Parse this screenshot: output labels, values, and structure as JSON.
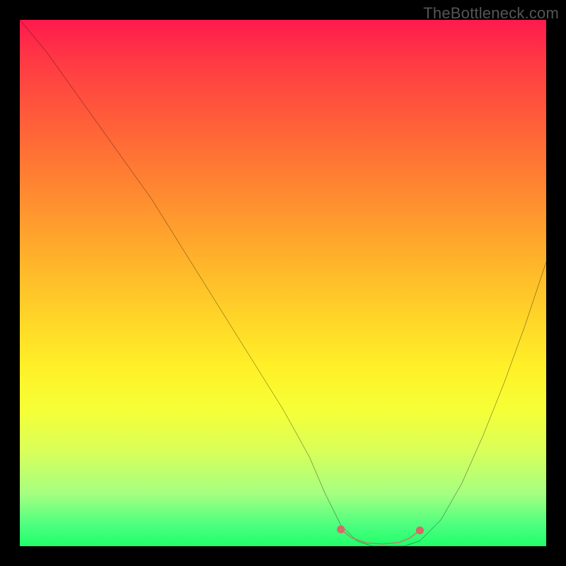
{
  "attribution": "TheBottleneck.com",
  "chart_data": {
    "type": "line",
    "title": "",
    "xlabel": "",
    "ylabel": "",
    "xlim": [
      0,
      100
    ],
    "ylim": [
      0,
      100
    ],
    "series": [
      {
        "name": "curve",
        "x": [
          0,
          5,
          10,
          15,
          20,
          25,
          30,
          35,
          40,
          45,
          50,
          55,
          58,
          61,
          64,
          67,
          70,
          73,
          76,
          80,
          84,
          88,
          92,
          96,
          100
        ],
        "values": [
          100,
          94,
          87,
          80,
          73,
          66,
          58,
          50,
          42,
          34,
          26,
          17,
          10,
          4,
          1,
          0,
          0,
          0,
          1,
          5,
          12,
          21,
          31,
          42,
          54
        ]
      },
      {
        "name": "marker-segment",
        "x": [
          61,
          63,
          66,
          69,
          72,
          74,
          76
        ],
        "values": [
          3.2,
          1.6,
          0.6,
          0.4,
          0.7,
          1.5,
          3.0
        ]
      }
    ],
    "colors": {
      "curve": "#000000",
      "marker": "#d46a6a",
      "gradient_top": "#ff1a4d",
      "gradient_bottom": "#1fff6a"
    }
  }
}
